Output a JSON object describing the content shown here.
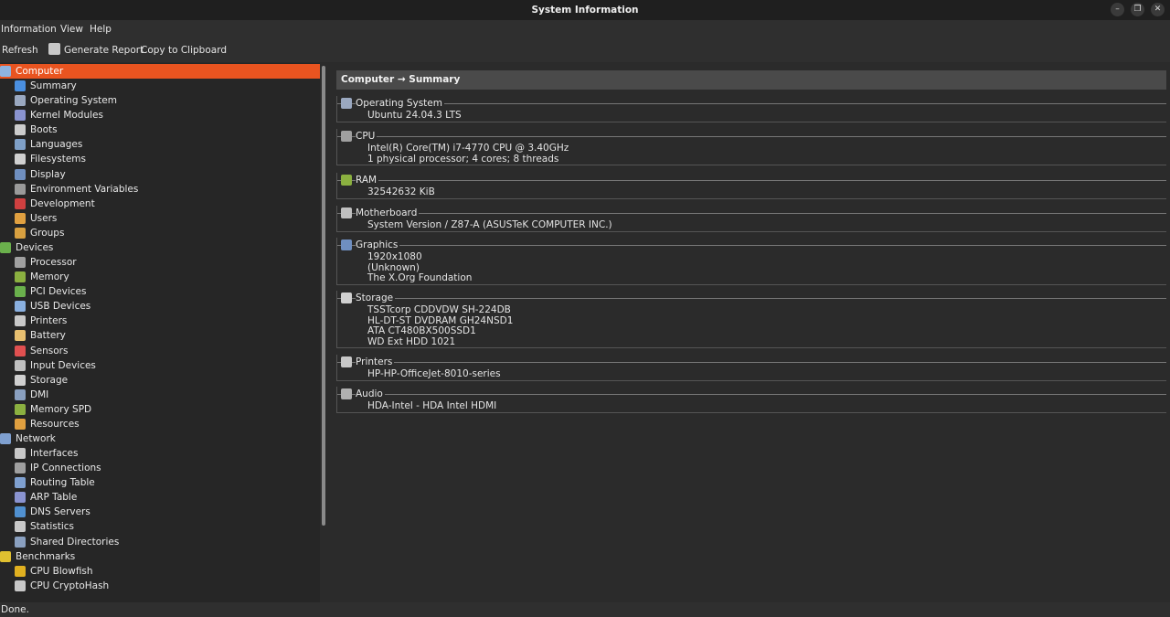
{
  "window": {
    "title": "System Information",
    "minimize": "–",
    "maximize": "❐",
    "close": "✕"
  },
  "menubar": [
    "Information",
    "View",
    "Help"
  ],
  "toolbar": {
    "refresh": "Refresh",
    "generate_report": "Generate Report",
    "copy_clipboard": "Copy to Clipboard"
  },
  "sidebar": {
    "items": [
      {
        "label": "Computer",
        "level": 0,
        "icon": "computer-icon",
        "selected": true,
        "color": "#8fb4e0"
      },
      {
        "label": "Summary",
        "level": 1,
        "icon": "info-icon",
        "color": "#4a8fe0"
      },
      {
        "label": "Operating System",
        "level": 1,
        "icon": "gear-icon",
        "color": "#9aa8c0"
      },
      {
        "label": "Kernel Modules",
        "level": 1,
        "icon": "module-icon",
        "color": "#8a93d0"
      },
      {
        "label": "Boots",
        "level": 1,
        "icon": "power-icon",
        "color": "#cccccc"
      },
      {
        "label": "Languages",
        "level": 1,
        "icon": "language-icon",
        "color": "#7fa0c8"
      },
      {
        "label": "Filesystems",
        "level": 1,
        "icon": "drive-icon",
        "color": "#d0d0d0"
      },
      {
        "label": "Display",
        "level": 1,
        "icon": "monitor-icon",
        "color": "#6f8fc0"
      },
      {
        "label": "Environment Variables",
        "level": 1,
        "icon": "terminal-icon",
        "color": "#9a9a9a"
      },
      {
        "label": "Development",
        "level": 1,
        "icon": "toolbox-icon",
        "color": "#d04040"
      },
      {
        "label": "Users",
        "level": 1,
        "icon": "users-icon",
        "color": "#e0a040"
      },
      {
        "label": "Groups",
        "level": 1,
        "icon": "groups-icon",
        "color": "#d8a040"
      },
      {
        "label": "Devices",
        "level": 0,
        "icon": "board-icon",
        "color": "#6ab04c"
      },
      {
        "label": "Processor",
        "level": 1,
        "icon": "cpu-icon",
        "color": "#a0a0a0"
      },
      {
        "label": "Memory",
        "level": 1,
        "icon": "memory-icon",
        "color": "#8bb040"
      },
      {
        "label": "PCI Devices",
        "level": 1,
        "icon": "pci-icon",
        "color": "#6ab04c"
      },
      {
        "label": "USB Devices",
        "level": 1,
        "icon": "usb-icon",
        "color": "#8ab0e0"
      },
      {
        "label": "Printers",
        "level": 1,
        "icon": "printer-icon",
        "color": "#c8c8c8"
      },
      {
        "label": "Battery",
        "level": 1,
        "icon": "battery-icon",
        "color": "#e8c070"
      },
      {
        "label": "Sensors",
        "level": 1,
        "icon": "sensor-icon",
        "color": "#e05050"
      },
      {
        "label": "Input Devices",
        "level": 1,
        "icon": "keyboard-icon",
        "color": "#c0c0c0"
      },
      {
        "label": "Storage",
        "level": 1,
        "icon": "storage-icon",
        "color": "#d0d0d0"
      },
      {
        "label": "DMI",
        "level": 1,
        "icon": "dmi-icon",
        "color": "#8aa0c0"
      },
      {
        "label": "Memory SPD",
        "level": 1,
        "icon": "memory-spd-icon",
        "color": "#8bb040"
      },
      {
        "label": "Resources",
        "level": 1,
        "icon": "resources-icon",
        "color": "#e0a040"
      },
      {
        "label": "Network",
        "level": 0,
        "icon": "network-icon",
        "color": "#7fa0d0"
      },
      {
        "label": "Interfaces",
        "level": 1,
        "icon": "interfaces-icon",
        "color": "#c8c8c8"
      },
      {
        "label": "IP Connections",
        "level": 1,
        "icon": "ip-connections-icon",
        "color": "#a0a0a0"
      },
      {
        "label": "Routing Table",
        "level": 1,
        "icon": "routing-icon",
        "color": "#7fa0d0"
      },
      {
        "label": "ARP Table",
        "level": 1,
        "icon": "arp-icon",
        "color": "#8a93d0"
      },
      {
        "label": "DNS Servers",
        "level": 1,
        "icon": "dns-icon",
        "color": "#5090d0"
      },
      {
        "label": "Statistics",
        "level": 1,
        "icon": "statistics-icon",
        "color": "#c8c8c8"
      },
      {
        "label": "Shared Directories",
        "level": 1,
        "icon": "folder-icon",
        "color": "#8aa0c0"
      },
      {
        "label": "Benchmarks",
        "level": 0,
        "icon": "benchmark-icon",
        "color": "#e0c030"
      },
      {
        "label": "CPU Blowfish",
        "level": 1,
        "icon": "blowfish-icon",
        "color": "#e0b020"
      },
      {
        "label": "CPU CryptoHash",
        "level": 1,
        "icon": "cryptohash-icon",
        "color": "#c8c8c8"
      }
    ]
  },
  "content": {
    "breadcrumb": "Computer → Summary",
    "sections": [
      {
        "title": "Operating System",
        "icon": "gear-icon",
        "color": "#9aa8c0",
        "values": [
          "Ubuntu 24.04.3 LTS"
        ]
      },
      {
        "title": "CPU",
        "icon": "cpu-icon",
        "color": "#a0a0a0",
        "values": [
          "Intel(R) Core(TM) i7-4770 CPU @ 3.40GHz",
          "1 physical processor; 4 cores; 8 threads"
        ]
      },
      {
        "title": "RAM",
        "icon": "memory-icon",
        "color": "#8bb040",
        "values": [
          "32542632 KiB"
        ]
      },
      {
        "title": "Motherboard",
        "icon": "motherboard-icon",
        "color": "#c0c0c0",
        "values": [
          "System Version / Z87-A (ASUSTeK COMPUTER INC.)"
        ]
      },
      {
        "title": "Graphics",
        "icon": "monitor-icon",
        "color": "#6f8fc0",
        "values": [
          "1920x1080",
          "(Unknown)",
          "The X.Org Foundation"
        ]
      },
      {
        "title": "Storage",
        "icon": "storage-icon",
        "color": "#d0d0d0",
        "values": [
          "TSSTcorp CDDVDW SH-224DB",
          "HL-DT-ST DVDRAM GH24NSD1",
          "ATA CT480BX500SSD1",
          "WD Ext HDD 1021"
        ]
      },
      {
        "title": "Printers",
        "icon": "printer-icon",
        "color": "#c8c8c8",
        "values": [
          "HP-HP-OfficeJet-8010-series"
        ]
      },
      {
        "title": "Audio",
        "icon": "audio-icon",
        "color": "#b0b0b0",
        "values": [
          "HDA-Intel - HDA Intel HDMI"
        ]
      }
    ]
  },
  "status": "Done.",
  "colors": {
    "accent": "#e95420",
    "background": "#2b2b2b",
    "sidebar": "#262626"
  }
}
